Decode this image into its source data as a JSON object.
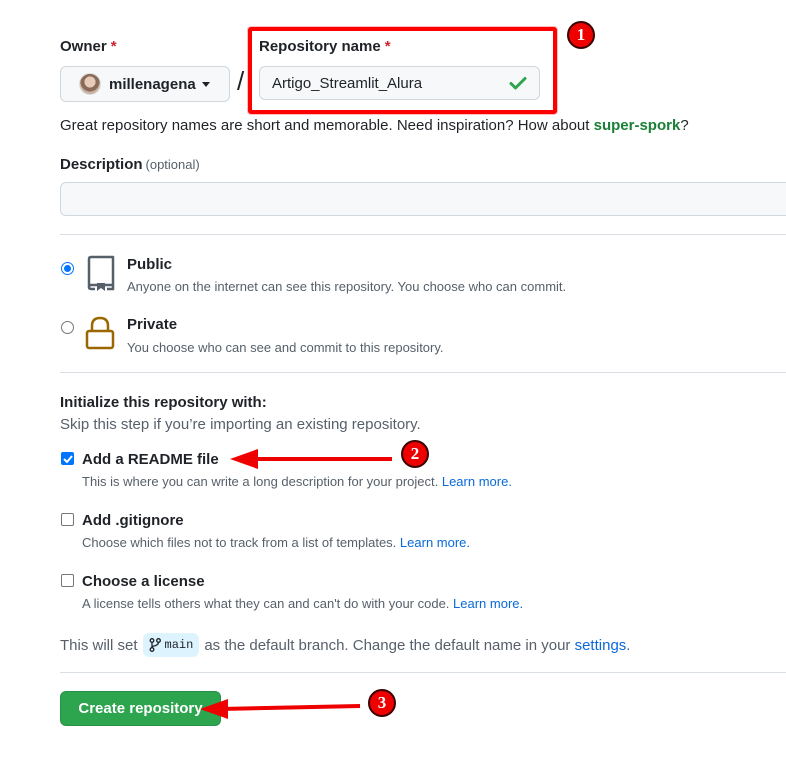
{
  "owner": {
    "label": "Owner",
    "required_mark": "*",
    "selected": "millenagena"
  },
  "separator": "/",
  "repository": {
    "label": "Repository name",
    "required_mark": "*",
    "value": "Artigo_Streamlit_Alura",
    "valid": true,
    "hint_prefix": "Great repository names are short and memorable. Need inspiration? How about ",
    "hint_suggestion": "super-spork",
    "hint_suffix": "?"
  },
  "description": {
    "label": "Description",
    "optional_label": "(optional)",
    "value": "",
    "placeholder": ""
  },
  "visibility": {
    "selected": "public",
    "options": [
      {
        "id": "public",
        "title": "Public",
        "description": "Anyone on the internet can see this repository. You choose who can commit.",
        "icon": "repo-book-icon"
      },
      {
        "id": "private",
        "title": "Private",
        "description": "You choose who can see and commit to this repository.",
        "icon": "lock-icon"
      }
    ]
  },
  "initialize": {
    "title": "Initialize this repository with:",
    "subtitle": "Skip this step if you’re importing an existing repository.",
    "options": [
      {
        "title": "Add a README file",
        "description": "This is where you can write a long description for your project. ",
        "link": "Learn more.",
        "checked": true
      },
      {
        "title": "Add .gitignore",
        "description": "Choose which files not to track from a list of templates. ",
        "link": "Learn more.",
        "checked": false
      },
      {
        "title": "Choose a license",
        "description": "A license tells others what they can and can't do with your code. ",
        "link": "Learn more.",
        "checked": false
      }
    ]
  },
  "branch": {
    "prefix": "This will set",
    "name": "main",
    "middle": "as the default branch. Change the default name in your",
    "link": "settings",
    "suffix": "."
  },
  "actions": {
    "create_label": "Create repository"
  },
  "annotations": {
    "badges": [
      "1",
      "2",
      "3"
    ],
    "color": "#ff0000"
  }
}
